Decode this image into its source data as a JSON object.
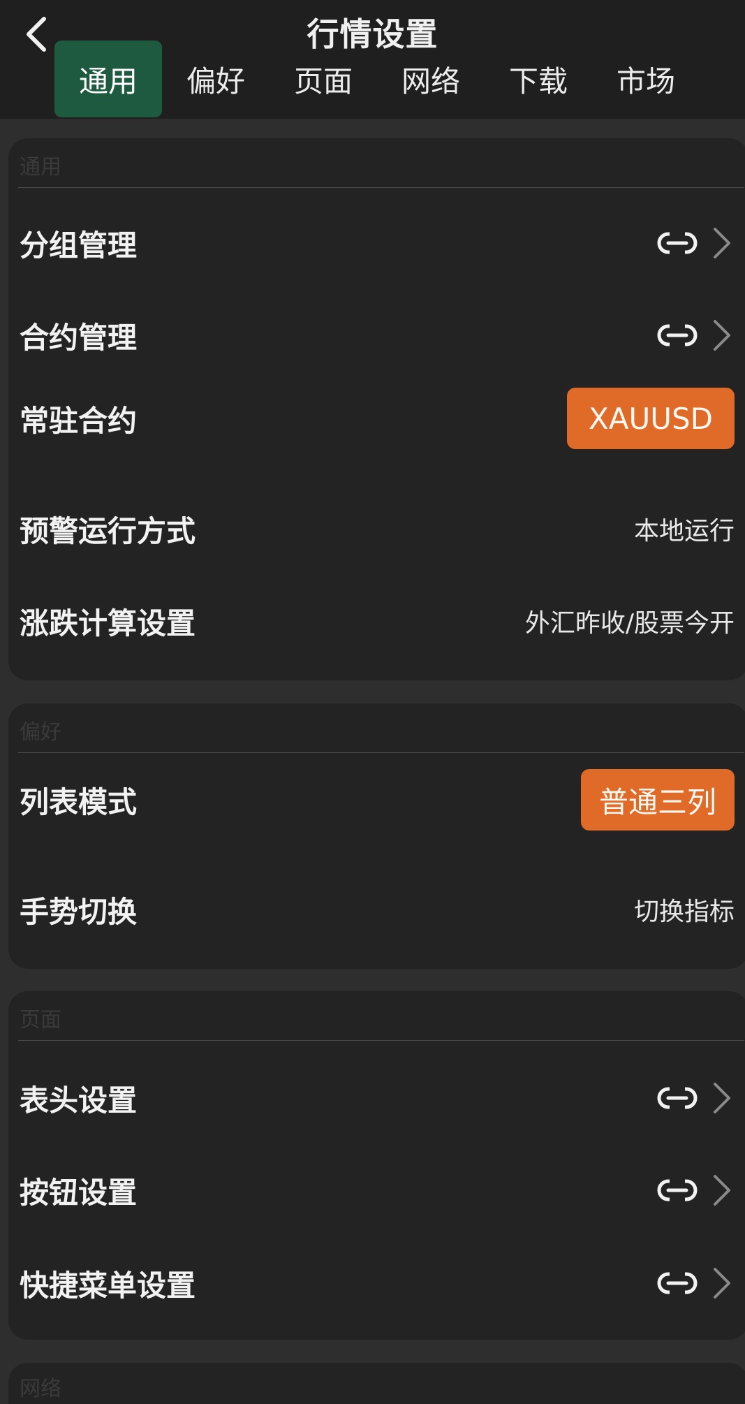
{
  "header": {
    "title": "行情设置",
    "tabs": [
      {
        "label": "通用",
        "active": true
      },
      {
        "label": "偏好",
        "active": false
      },
      {
        "label": "页面",
        "active": false
      },
      {
        "label": "网络",
        "active": false
      },
      {
        "label": "下载",
        "active": false
      },
      {
        "label": "市场",
        "active": false
      }
    ]
  },
  "sections": {
    "general": {
      "title": "通用",
      "group_management": {
        "label": "分组管理",
        "icons": [
          "link-icon",
          "chevron-right-icon"
        ]
      },
      "contract_management": {
        "label": "合约管理",
        "icons": [
          "link-icon",
          "chevron-right-icon"
        ]
      },
      "resident_contract": {
        "label": "常驻合约",
        "value": "XAUUSD"
      },
      "alert_mode": {
        "label": "预警运行方式",
        "value": "本地运行"
      },
      "change_calc": {
        "label": "涨跌计算设置",
        "value": "外汇昨收/股票今开"
      }
    },
    "preference": {
      "title": "偏好",
      "list_mode": {
        "label": "列表模式",
        "value": "普通三列"
      },
      "gesture_switch": {
        "label": "手势切换",
        "value": "切换指标"
      }
    },
    "page": {
      "title": "页面",
      "header_settings": {
        "label": "表头设置",
        "icons": [
          "link-icon",
          "chevron-right-icon"
        ]
      },
      "button_settings": {
        "label": "按钮设置",
        "icons": [
          "link-icon",
          "chevron-right-icon"
        ]
      },
      "quick_menu_settings": {
        "label": "快捷菜单设置",
        "icons": [
          "link-icon",
          "chevron-right-icon"
        ]
      }
    },
    "network": {
      "title": "网络"
    }
  },
  "colors": {
    "background": "#2e2e2e",
    "header": "#1f1f1f",
    "card": "#232323",
    "active_tab": "#1e5a40",
    "accent_pill": "#e06a28",
    "section_title": "#3a3a3a"
  }
}
